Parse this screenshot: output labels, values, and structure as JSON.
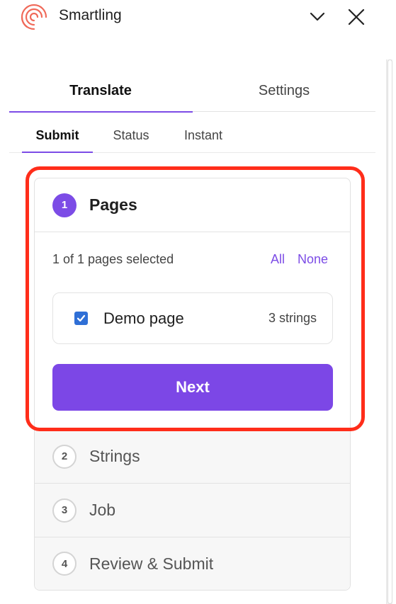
{
  "app": {
    "title": "Smartling"
  },
  "main_tabs": [
    {
      "label": "Translate",
      "active": true
    },
    {
      "label": "Settings",
      "active": false
    }
  ],
  "sub_tabs": [
    {
      "label": "Submit",
      "active": true
    },
    {
      "label": "Status",
      "active": false
    },
    {
      "label": "Instant",
      "active": false
    }
  ],
  "steps": [
    {
      "number": "1",
      "label": "Pages",
      "active": true
    },
    {
      "number": "2",
      "label": "Strings",
      "active": false
    },
    {
      "number": "3",
      "label": "Job",
      "active": false
    },
    {
      "number": "4",
      "label": "Review & Submit",
      "active": false
    }
  ],
  "pages_step": {
    "selection_text": "1 of 1 pages selected",
    "select_all_label": "All",
    "select_none_label": "None",
    "pages": [
      {
        "name": "Demo page",
        "strings": "3 strings",
        "checked": true
      }
    ],
    "next_label": "Next"
  },
  "colors": {
    "accent": "#7c4ce6",
    "checkbox": "#2f6fd6",
    "highlight": "#ff2d1a",
    "logo": "#f06a5a"
  },
  "icons": {
    "logo": "smartling-logo-icon",
    "collapse": "chevron-down-icon",
    "close": "close-icon",
    "check": "check-icon"
  }
}
